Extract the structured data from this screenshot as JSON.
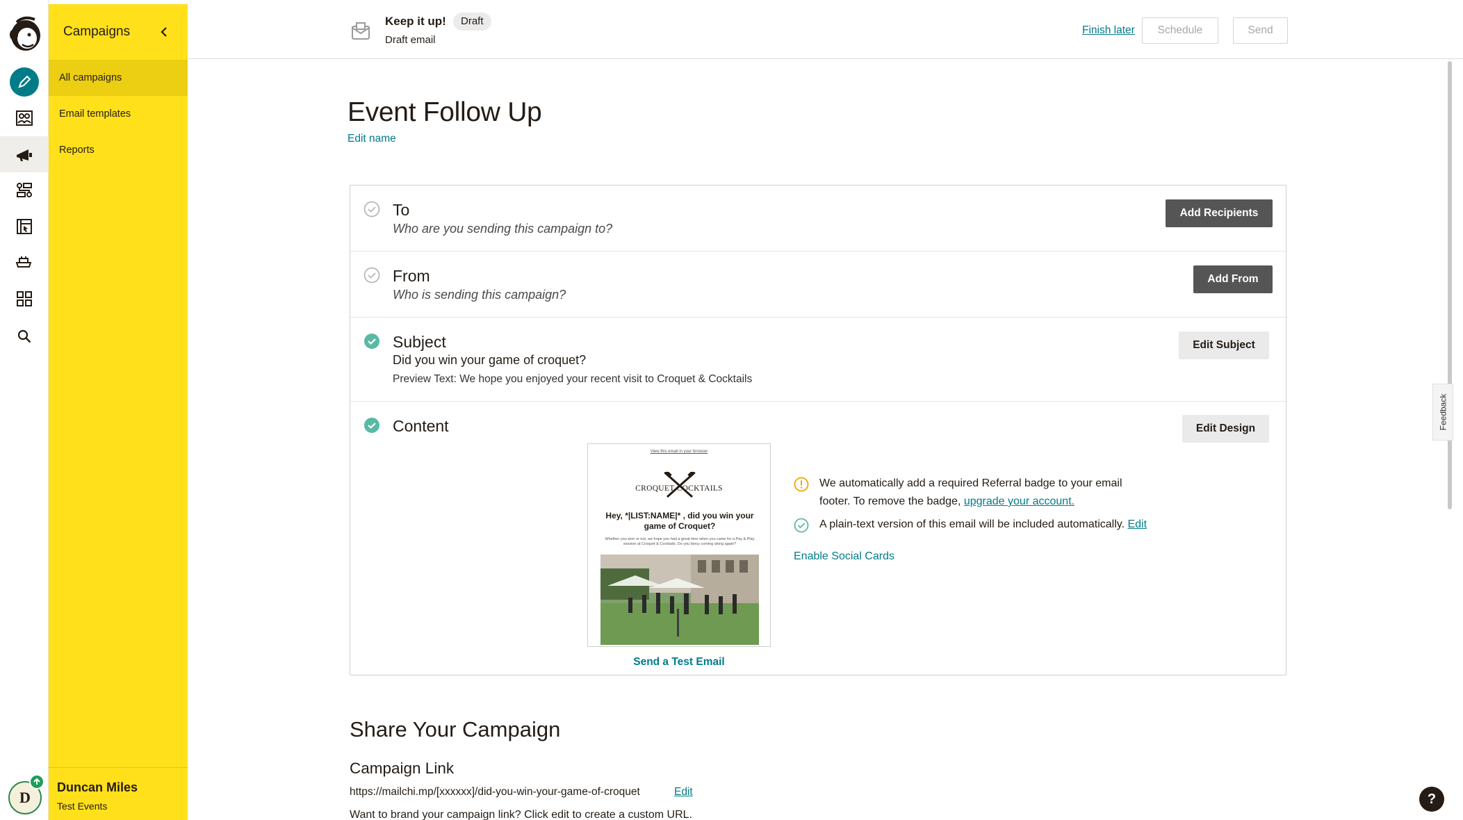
{
  "sidebar": {
    "title": "Campaigns",
    "items": [
      {
        "label": "All campaigns",
        "active": true
      },
      {
        "label": "Email templates",
        "active": false
      },
      {
        "label": "Reports",
        "active": false
      }
    ],
    "user": {
      "name": "Duncan Miles",
      "org": "Test Events",
      "initial": "D"
    }
  },
  "rail_icons": [
    "create-pencil-icon",
    "audience-icon",
    "campaigns-megaphone-icon",
    "automations-icon",
    "website-icon",
    "integrations-icon",
    "apps-grid-icon",
    "search-icon"
  ],
  "topbar": {
    "title": "Keep it up!",
    "badge": "Draft",
    "subtitle": "Draft email",
    "finish_later": "Finish later",
    "schedule": "Schedule",
    "send": "Send"
  },
  "campaign": {
    "name": "Event Follow Up",
    "edit_name": "Edit name"
  },
  "sections": {
    "to": {
      "label": "To",
      "desc": "Who are you sending this campaign to?",
      "button": "Add Recipients",
      "complete": false
    },
    "from": {
      "label": "From",
      "desc": "Who is sending this campaign?",
      "button": "Add From",
      "complete": false
    },
    "subject": {
      "label": "Subject",
      "value": "Did you win your game of croquet?",
      "preview": "Preview Text: We hope you enjoyed your recent visit to Croquet & Cocktails",
      "button": "Edit Subject",
      "complete": true
    },
    "content": {
      "label": "Content",
      "button": "Edit Design",
      "complete": true,
      "preview": {
        "view_link": "View this email in your browser",
        "brand": "CROQUET COCKTAILS",
        "headline": "Hey, *|LIST:NAME|* , did you win your game of Croquet?",
        "body": "Whether you won or not, we hope you had a great time when you came for a Pay & Play session at Croquet & Cocktails. Do you fancy coming along again?"
      },
      "send_test": "Send a Test Email",
      "notice_badge": "We automatically add a required Referral badge to your email",
      "notice_badge_2": "footer. To remove the badge,",
      "notice_badge_link": "upgrade your account.",
      "notice_plain": "A plain-text version of this email will be included automatically.",
      "notice_plain_link": "Edit",
      "social_cards": "Enable Social Cards"
    }
  },
  "share": {
    "title": "Share Your Campaign",
    "link_title": "Campaign Link",
    "url": "https://mailchi.mp/[xxxxxx]/did-you-win-your-game-of-croquet",
    "edit": "Edit",
    "brand_prompt": "Want to brand your campaign link? Click edit to create a custom URL."
  },
  "feedback": "Feedback",
  "help": "?",
  "colors": {
    "yellow": "#ffe01b",
    "teal": "#007c89",
    "dark_button": "#555555"
  }
}
